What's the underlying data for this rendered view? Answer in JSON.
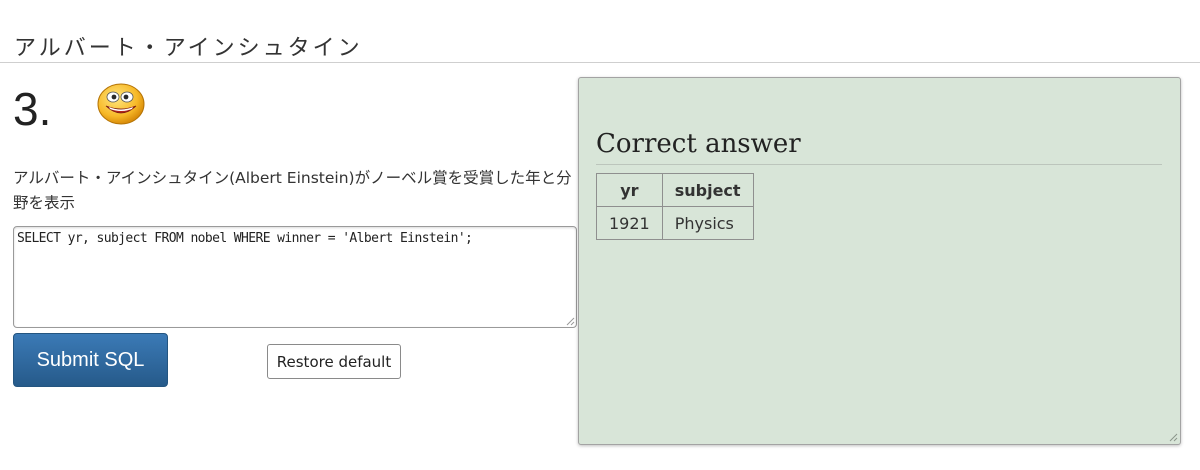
{
  "section": {
    "heading": "アルバート・アインシュタイン"
  },
  "question": {
    "number": "3.",
    "status_icon": "smiley-face-icon",
    "text": "アルバート・アインシュタイン(Albert Einstein)がノーベル賞を受賞した年と分野を表示",
    "sql": "SELECT yr, subject FROM nobel WHERE winner = 'Albert Einstein';"
  },
  "buttons": {
    "submit_label": "Submit SQL",
    "restore_label": "Restore default"
  },
  "answer": {
    "title": "Correct answer",
    "columns": [
      "yr",
      "subject"
    ],
    "rows": [
      [
        "1921",
        "Physics"
      ]
    ]
  },
  "colors": {
    "answer_panel_bg": "#d8e5d8",
    "submit_button_bg": "#2d6ca2"
  }
}
